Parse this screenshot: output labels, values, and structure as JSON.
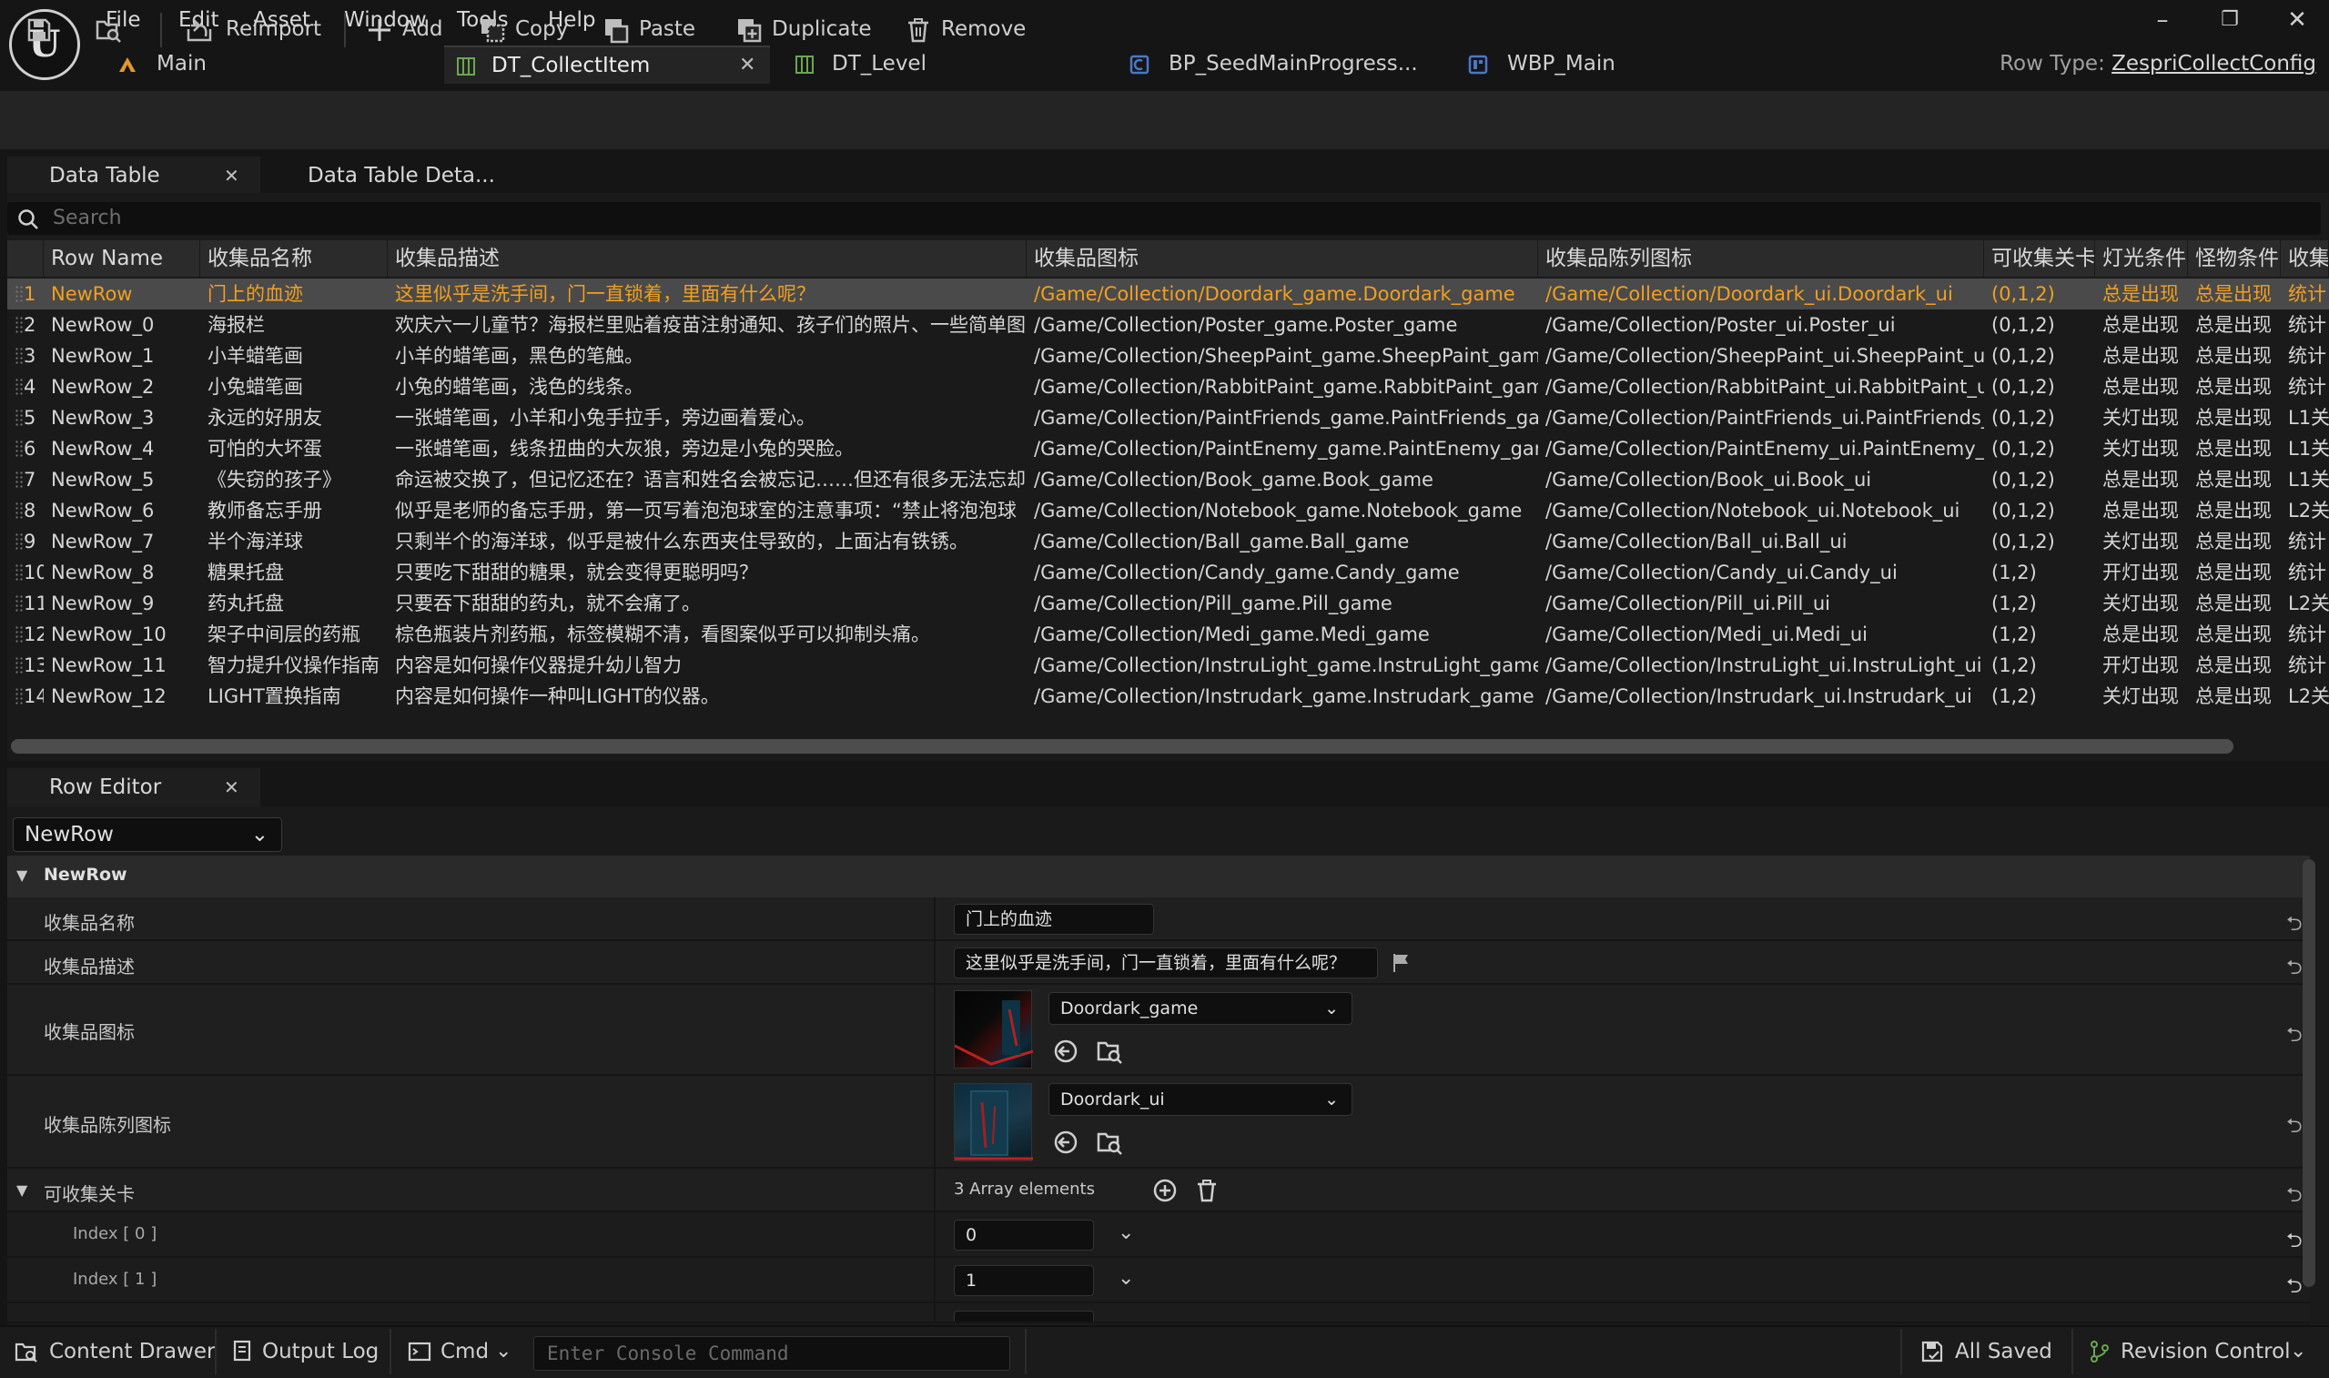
{
  "menu": [
    "File",
    "Edit",
    "Asset",
    "Window",
    "Tools",
    "Help"
  ],
  "tabs": [
    {
      "label": "Main",
      "icon": "level-icon"
    },
    {
      "label": "DT_CollectItem",
      "icon": "datatable-icon",
      "active": true
    },
    {
      "label": "DT_Level",
      "icon": "datatable-icon"
    },
    {
      "label": "BP_SeedMainProgress...",
      "icon": "blueprint-icon"
    },
    {
      "label": "WBP_Main",
      "icon": "widget-blueprint-icon"
    }
  ],
  "row_type": {
    "label": "Row Type:",
    "value": "ZespriCollectConfig"
  },
  "toolbar": {
    "reimport": "Reimport",
    "add": "Add",
    "copy": "Copy",
    "paste": "Paste",
    "duplicate": "Duplicate",
    "remove": "Remove"
  },
  "panel_tabs": {
    "data_table": "Data Table",
    "data_table_details": "Data Table Deta..."
  },
  "search": {
    "placeholder": "Search"
  },
  "table": {
    "headers": [
      "Row Name",
      "收集品名称",
      "收集品描述",
      "收集品图标",
      "收集品陈列图标",
      "可收集关卡",
      "灯光条件",
      "怪物条件",
      "收集"
    ],
    "rows": [
      [
        "1",
        "NewRow",
        "门上的血迹",
        "这里似乎是洗手间，门一直锁着，里面有什么呢？",
        "/Game/Collection/Doordark_game.Doordark_game",
        "/Game/Collection/Doordark_ui.Doordark_ui",
        "(0,1,2)",
        "总是出现",
        "总是出现",
        "统计"
      ],
      [
        "2",
        "NewRow_0",
        "海报栏",
        "欢庆六一儿童节？海报栏里贴着疫苗注射通知、孩子们的照片、一些简单图",
        "/Game/Collection/Poster_game.Poster_game",
        "/Game/Collection/Poster_ui.Poster_ui",
        "(0,1,2)",
        "总是出现",
        "总是出现",
        "统计"
      ],
      [
        "3",
        "NewRow_1",
        "小羊蜡笔画",
        "小羊的蜡笔画，黑色的笔触。",
        "/Game/Collection/SheepPaint_game.SheepPaint_game",
        "/Game/Collection/SheepPaint_ui.SheepPaint_ui",
        "(0,1,2)",
        "总是出现",
        "总是出现",
        "统计"
      ],
      [
        "4",
        "NewRow_2",
        "小兔蜡笔画",
        "小兔的蜡笔画，浅色的线条。",
        "/Game/Collection/RabbitPaint_game.RabbitPaint_game",
        "/Game/Collection/RabbitPaint_ui.RabbitPaint_ui",
        "(0,1,2)",
        "总是出现",
        "总是出现",
        "统计"
      ],
      [
        "5",
        "NewRow_3",
        "永远的好朋友",
        "一张蜡笔画，小羊和小兔手拉手，旁边画着爱心。",
        "/Game/Collection/PaintFriends_game.PaintFriends_game",
        "/Game/Collection/PaintFriends_ui.PaintFriends_ui",
        "(0,1,2)",
        "关灯出现",
        "总是出现",
        "L1关"
      ],
      [
        "6",
        "NewRow_4",
        "可怕的大坏蛋",
        "一张蜡笔画，线条扭曲的大灰狼，旁边是小兔的哭脸。",
        "/Game/Collection/PaintEnemy_game.PaintEnemy_game",
        "/Game/Collection/PaintEnemy_ui.PaintEnemy_ui",
        "(0,1,2)",
        "关灯出现",
        "总是出现",
        "L1关"
      ],
      [
        "7",
        "NewRow_5",
        "《失窃的孩子》",
        "命运被交换了，但记忆还在？语言和姓名会被忘记……但还有很多无法忘却的",
        "/Game/Collection/Book_game.Book_game",
        "/Game/Collection/Book_ui.Book_ui",
        "(0,1,2)",
        "总是出现",
        "总是出现",
        "L1关"
      ],
      [
        "8",
        "NewRow_6",
        "教师备忘手册",
        "似乎是老师的备忘手册，第一页写着泡泡球室的注意事项：“禁止将泡泡球",
        "/Game/Collection/Notebook_game.Notebook_game",
        "/Game/Collection/Notebook_ui.Notebook_ui",
        "(0,1,2)",
        "总是出现",
        "总是出现",
        "L2关"
      ],
      [
        "9",
        "NewRow_7",
        "半个海洋球",
        "只剩半个的海洋球，似乎是被什么东西夹住导致的，上面沾有铁锈。",
        "/Game/Collection/Ball_game.Ball_game",
        "/Game/Collection/Ball_ui.Ball_ui",
        "(0,1,2)",
        "关灯出现",
        "总是出现",
        "统计"
      ],
      [
        "10",
        "NewRow_8",
        "糖果托盘",
        "只要吃下甜甜的糖果，就会变得更聪明吗？",
        "/Game/Collection/Candy_game.Candy_game",
        "/Game/Collection/Candy_ui.Candy_ui",
        "(1,2)",
        "开灯出现",
        "总是出现",
        "统计"
      ],
      [
        "11",
        "NewRow_9",
        "药丸托盘",
        "只要吞下甜甜的药丸，就不会痛了。",
        "/Game/Collection/Pill_game.Pill_game",
        "/Game/Collection/Pill_ui.Pill_ui",
        "(1,2)",
        "关灯出现",
        "总是出现",
        "L2关"
      ],
      [
        "12",
        "NewRow_10",
        "架子中间层的药瓶",
        "棕色瓶装片剂药瓶，标签模糊不清，看图案似乎可以抑制头痛。",
        "/Game/Collection/Medi_game.Medi_game",
        "/Game/Collection/Medi_ui.Medi_ui",
        "(1,2)",
        "总是出现",
        "总是出现",
        "统计"
      ],
      [
        "13",
        "NewRow_11",
        "智力提升仪操作指南",
        "内容是如何操作仪器提升幼儿智力",
        "/Game/Collection/InstruLight_game.InstruLight_game",
        "/Game/Collection/InstruLight_ui.InstruLight_ui",
        "(1,2)",
        "开灯出现",
        "总是出现",
        "统计"
      ],
      [
        "14",
        "NewRow_12",
        "LIGHT置换指南",
        "内容是如何操作一种叫LIGHT的仪器。",
        "/Game/Collection/Instrudark_game.Instrudark_game",
        "/Game/Collection/Instrudark_ui.Instrudark_ui",
        "(1,2)",
        "关灯出现",
        "总是出现",
        "L2关"
      ]
    ]
  },
  "row_editor": {
    "tab": "Row Editor",
    "selected_row": "NewRow",
    "section": "NewRow",
    "props": {
      "name_label": "收集品名称",
      "name_value": "门上的血迹",
      "desc_label": "收集品描述",
      "desc_value": "这里似乎是洗手间，门一直锁着，里面有什么呢？",
      "icon_label": "收集品图标",
      "icon_value": "Doordark_game",
      "display_icon_label": "收集品陈列图标",
      "display_icon_value": "Doordark_ui",
      "levels_label": "可收集关卡",
      "levels_count": "3 Array elements",
      "index0_label": "Index [ 0 ]",
      "index0_value": "0",
      "index1_label": "Index [ 1 ]",
      "index1_value": "1"
    }
  },
  "statusbar": {
    "content_drawer": "Content Drawer",
    "output_log": "Output Log",
    "cmd": "Cmd",
    "console_placeholder": "Enter Console Command",
    "all_saved": "All Saved",
    "revision_control": "Revision Control"
  },
  "colors": {
    "selected_text": "#f0a020",
    "accent_green": "#6aa84f",
    "accent_blue": "#4a78c8"
  }
}
